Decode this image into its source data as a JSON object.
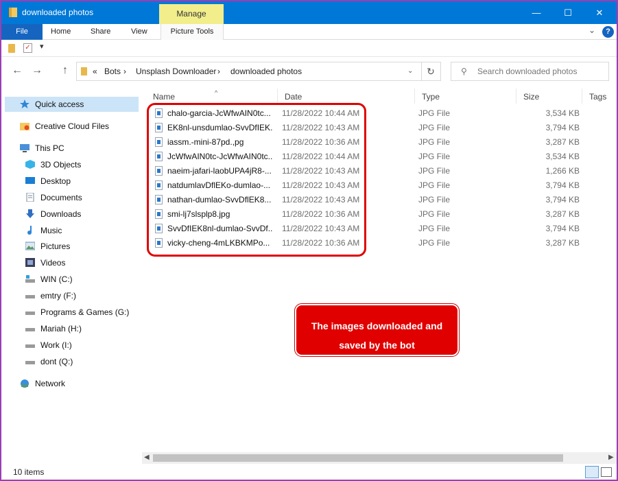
{
  "window": {
    "title": "downloaded photos",
    "manage_tab": "Manage",
    "controls": {
      "minimize": "—",
      "maximize": "☐",
      "close": "✕"
    }
  },
  "ribbon": {
    "tabs": [
      "File",
      "Home",
      "Share",
      "View",
      "Picture Tools"
    ],
    "collapse_icon": "chevron-down-icon",
    "help_label": "?"
  },
  "qat": {
    "dropdown": "▾"
  },
  "address": {
    "breadcrumbs": [
      "Bots",
      "Unsplash Downloader",
      "downloaded photos"
    ],
    "overflow": "«",
    "separator": "›",
    "search_placeholder": "Search downloaded photos"
  },
  "sidebar": {
    "items": [
      {
        "label": "Quick access",
        "icon": "star-icon",
        "selected": true
      },
      {
        "label": "Creative Cloud Files",
        "icon": "cloud-folder-icon"
      },
      {
        "label": "This PC",
        "icon": "computer-icon"
      },
      {
        "label": "3D Objects",
        "icon": "cube-icon"
      },
      {
        "label": "Desktop",
        "icon": "desktop-icon"
      },
      {
        "label": "Documents",
        "icon": "documents-icon"
      },
      {
        "label": "Downloads",
        "icon": "download-arrow-icon"
      },
      {
        "label": "Music",
        "icon": "music-note-icon"
      },
      {
        "label": "Pictures",
        "icon": "pictures-icon"
      },
      {
        "label": "Videos",
        "icon": "film-icon"
      },
      {
        "label": "WIN (C:)",
        "icon": "system-drive-icon"
      },
      {
        "label": "emtry (F:)",
        "icon": "drive-icon"
      },
      {
        "label": "Programs & Games (G:)",
        "icon": "drive-icon"
      },
      {
        "label": "Mariah (H:)",
        "icon": "drive-icon"
      },
      {
        "label": "Work (I:)",
        "icon": "drive-icon"
      },
      {
        "label": "dont (Q:)",
        "icon": "drive-icon"
      },
      {
        "label": "Network",
        "icon": "network-icon"
      }
    ]
  },
  "columns": {
    "name": "Name",
    "date": "Date",
    "type": "Type",
    "size": "Size",
    "tags": "Tags",
    "sort_indicator": "^"
  },
  "files": [
    {
      "name": "chalo-garcia-JcWfwAIN0tc...",
      "date": "11/28/2022 10:44 AM",
      "type": "JPG File",
      "size": "3,534 KB"
    },
    {
      "name": "EK8nl-unsdumlao-SvvDfIEK...",
      "date": "11/28/2022 10:43 AM",
      "type": "JPG File",
      "size": "3,794 KB"
    },
    {
      "name": "iassm.-mini-87pd.,pg",
      "date": "11/28/2022 10:36 AM",
      "type": "JPG File",
      "size": "3,287 KB"
    },
    {
      "name": "JcWfwAIN0tc-JcWfwAIN0tc...",
      "date": "11/28/2022 10:44 AM",
      "type": "JPG File",
      "size": "3,534 KB"
    },
    {
      "name": "naeim-jafari-laobUPA4jR8-...",
      "date": "11/28/2022 10:43 AM",
      "type": "JPG File",
      "size": "1,266 KB"
    },
    {
      "name": "natdumlavDflEKo-dumlao-...",
      "date": "11/28/2022 10:43 AM",
      "type": "JPG File",
      "size": "3,794 KB"
    },
    {
      "name": "nathan-dumlao-SvvDflEK8...",
      "date": "11/28/2022 10:43 AM",
      "type": "JPG File",
      "size": "3,794 KB"
    },
    {
      "name": "smi-lj7slsplp8.jpg",
      "date": "11/28/2022 10:36 AM",
      "type": "JPG File",
      "size": "3,287 KB"
    },
    {
      "name": "SvvDfIEK8nl-dumlao-SvvDf...",
      "date": "11/28/2022 10:43 AM",
      "type": "JPG File",
      "size": "3,794 KB"
    },
    {
      "name": "vicky-cheng-4mLKBKMPo...",
      "date": "11/28/2022 10:36 AM",
      "type": "JPG File",
      "size": "3,287 KB"
    }
  ],
  "annotation": {
    "line1": "The images downloaded and",
    "line2": "saved by the bot",
    "color": "#e00000"
  },
  "status": {
    "item_count": "10 items"
  },
  "colors": {
    "titlebar": "#0078d7",
    "manage": "#f2ee8b",
    "selected": "#cce4f7",
    "border": "#9b3fb5"
  }
}
